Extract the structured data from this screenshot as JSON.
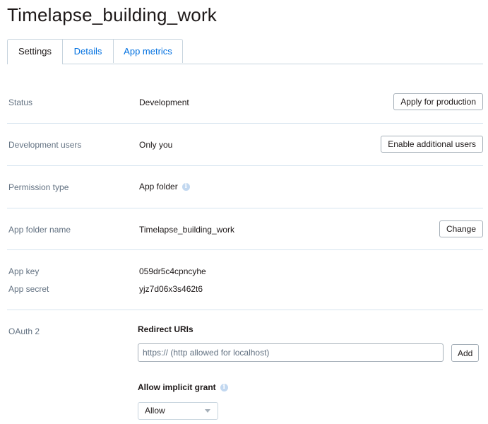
{
  "app": {
    "title": "Timelapse_building_work"
  },
  "tabs": [
    {
      "label": "Settings"
    },
    {
      "label": "Details"
    },
    {
      "label": "App metrics"
    }
  ],
  "status": {
    "label": "Status",
    "value": "Development",
    "button": "Apply for production"
  },
  "dev_users": {
    "label": "Development users",
    "value": "Only you",
    "button": "Enable additional users"
  },
  "permission": {
    "label": "Permission type",
    "value": "App folder",
    "icon": "info-icon"
  },
  "folder": {
    "label": "App folder name",
    "value": "Timelapse_building_work",
    "button": "Change"
  },
  "keys": {
    "key_label": "App key",
    "key_value": "059dr5c4cpncyhe",
    "secret_label": "App secret",
    "secret_value": "yjz7d06x3s462t6"
  },
  "oauth": {
    "label": "OAuth 2",
    "redirect_heading": "Redirect URIs",
    "redirect_placeholder": "https:// (http allowed for localhost)",
    "add_button": "Add",
    "implicit_heading": "Allow implicit grant",
    "implicit_value": "Allow",
    "icon": "info-icon"
  },
  "colors": {
    "link": "#0070e0",
    "divider": "#d6e4ef",
    "label": "#637282",
    "info_icon": "#c2d8f0"
  }
}
